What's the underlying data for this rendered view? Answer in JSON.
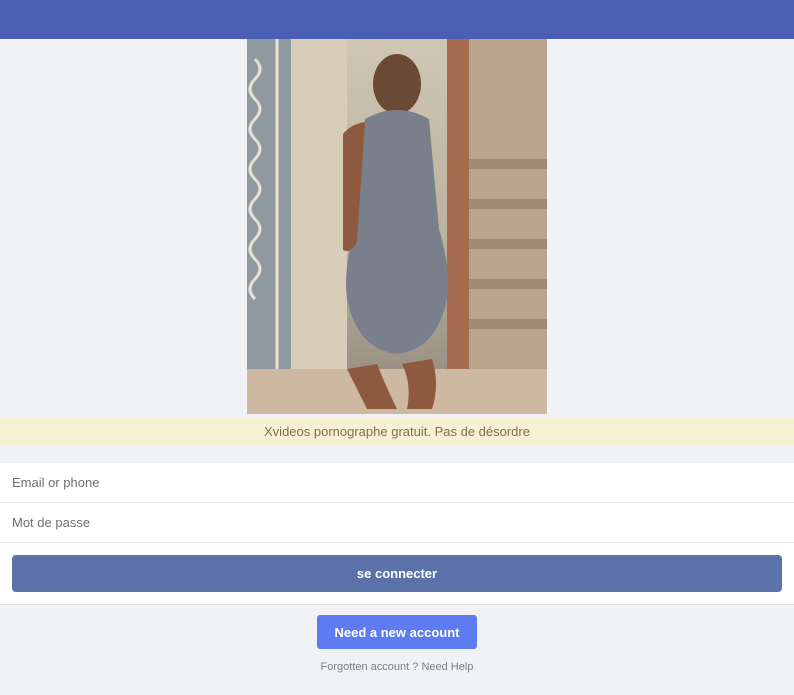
{
  "notice": {
    "text": "Xvideos pornographe gratuit. Pas de désordre"
  },
  "form": {
    "email_placeholder": "Email or phone",
    "password_placeholder": "Mot de passe",
    "login_label": "se connecter"
  },
  "footer": {
    "new_account_label": "Need a new account",
    "forgotten_label": "Forgotten account ?",
    "help_label": "Need Help"
  },
  "colors": {
    "topbar": "#4a5fb3",
    "login_button": "#5b72a9",
    "new_account_button": "#5e7bf1",
    "notice_background": "#f6f1d3"
  }
}
